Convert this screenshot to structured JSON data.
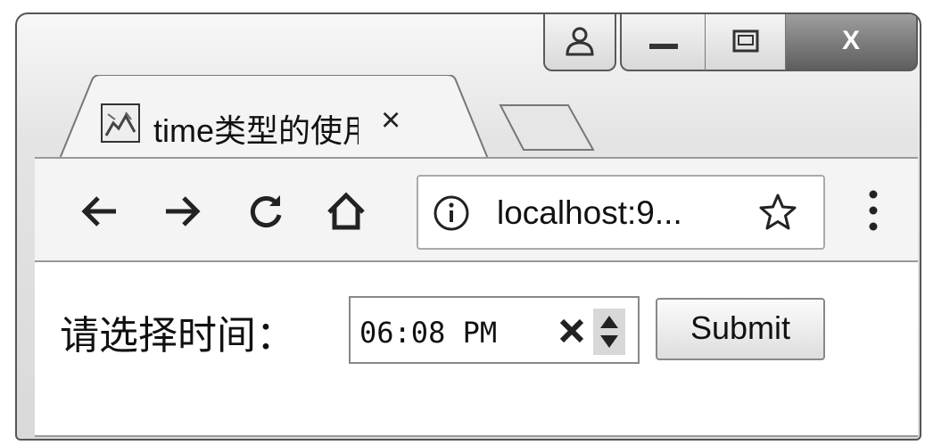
{
  "tab": {
    "title": "time类型的使用",
    "close_glyph": "×"
  },
  "caption": {
    "close_glyph": "X"
  },
  "omnibox": {
    "url": "localhost:9..."
  },
  "form": {
    "label": "请选择时间：",
    "time_value": "06:08 PM",
    "submit_label": "Submit"
  }
}
